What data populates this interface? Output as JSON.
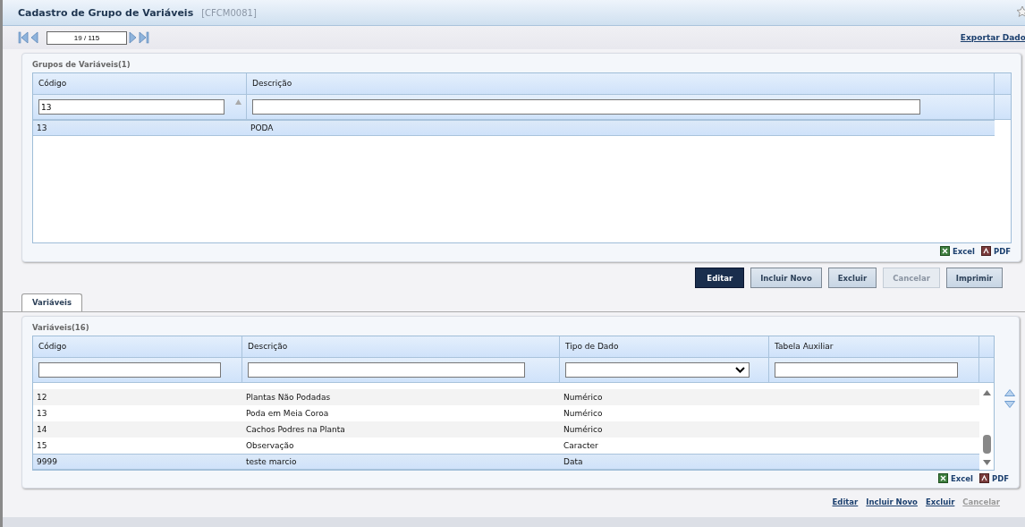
{
  "window": {
    "title": "Cadastro de Grupo de Variáveis",
    "code": "[CFCM0081]"
  },
  "pager": {
    "value": "19 / 115"
  },
  "export_link": "Exportar Dado",
  "groups_panel": {
    "title": "Grupos de Variáveis(1)",
    "columns": [
      {
        "label": "Código",
        "filter": "13",
        "sorted": true
      },
      {
        "label": "Descrição",
        "sorted": false
      }
    ],
    "rows": [
      {
        "cells": [
          "13",
          "PODA"
        ],
        "selected": true
      }
    ],
    "exports": [
      {
        "label": "Excel",
        "kind": "excel"
      },
      {
        "label": "PDF",
        "kind": "pdf"
      }
    ]
  },
  "buttons": [
    {
      "label": "Editar",
      "kind": "primary",
      "disabled": false
    },
    {
      "label": "Incluir Novo",
      "kind": "normal",
      "disabled": false
    },
    {
      "label": "Excluir",
      "kind": "normal",
      "disabled": false
    },
    {
      "label": "Cancelar",
      "kind": "normal",
      "disabled": true
    },
    {
      "label": "Imprimir",
      "kind": "normal",
      "disabled": false
    }
  ],
  "tabs": [
    {
      "label": "Variáveis",
      "selected": true
    }
  ],
  "variables_panel": {
    "title": "Variáveis(16)",
    "columns": [
      {
        "label": "Código",
        "kind": "text"
      },
      {
        "label": "Descrição",
        "kind": "text"
      },
      {
        "label": "Tipo de Dado",
        "kind": "select"
      },
      {
        "label": "Tabela Auxiliar",
        "kind": "text"
      }
    ],
    "rows": [
      {
        "cells": [
          "12",
          "Plantas Não Podadas",
          "Numérico",
          ""
        ],
        "selected": false
      },
      {
        "cells": [
          "13",
          "Poda em Meia Coroa",
          "Numérico",
          ""
        ],
        "selected": false
      },
      {
        "cells": [
          "14",
          "Cachos Podres na Planta",
          "Numérico",
          ""
        ],
        "selected": false
      },
      {
        "cells": [
          "15",
          "Observação",
          "Caracter",
          ""
        ],
        "selected": false
      },
      {
        "cells": [
          "9999",
          "teste marcio",
          "Data",
          ""
        ],
        "selected": true
      }
    ],
    "exports": [
      {
        "label": "Excel",
        "kind": "excel"
      },
      {
        "label": "PDF",
        "kind": "pdf"
      }
    ]
  },
  "links": [
    {
      "label": "Editar",
      "disabled": false
    },
    {
      "label": "Incluir Novo",
      "disabled": false
    },
    {
      "label": "Excluir",
      "disabled": false
    },
    {
      "label": "Cancelar",
      "disabled": true
    }
  ]
}
